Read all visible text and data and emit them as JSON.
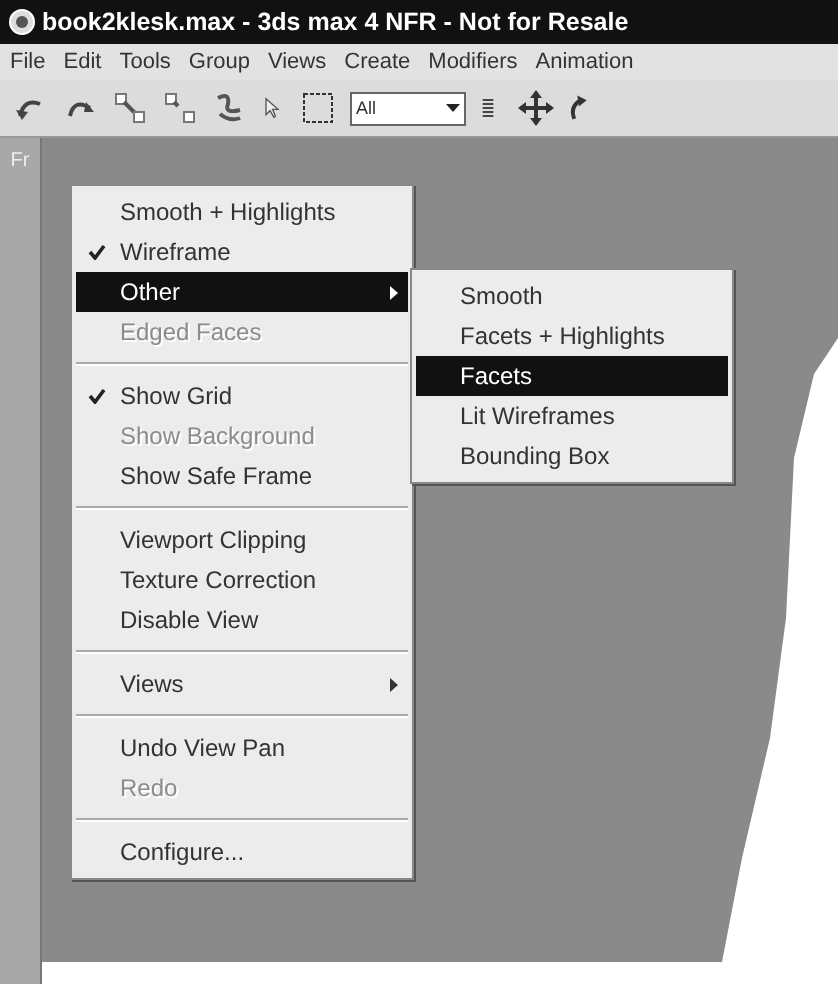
{
  "window": {
    "title": "book2klesk.max - 3ds max 4 NFR - Not for Resale"
  },
  "menu_bar": [
    "File",
    "Edit",
    "Tools",
    "Group",
    "Views",
    "Create",
    "Modifiers",
    "Animation"
  ],
  "toolbar": {
    "selection_filter": "All"
  },
  "viewport": {
    "label": "Fr"
  },
  "context_menu": [
    {
      "kind": "item",
      "label": "Smooth + Highlights",
      "checked": false,
      "disabled": false,
      "selected": false,
      "submenu": false
    },
    {
      "kind": "item",
      "label": "Wireframe",
      "checked": true,
      "disabled": false,
      "selected": false,
      "submenu": false
    },
    {
      "kind": "item",
      "label": "Other",
      "checked": false,
      "disabled": false,
      "selected": true,
      "submenu": true
    },
    {
      "kind": "item",
      "label": "Edged Faces",
      "checked": false,
      "disabled": true,
      "selected": false,
      "submenu": false
    },
    {
      "kind": "separator"
    },
    {
      "kind": "item",
      "label": "Show Grid",
      "checked": true,
      "disabled": false,
      "selected": false,
      "submenu": false
    },
    {
      "kind": "item",
      "label": "Show Background",
      "checked": false,
      "disabled": true,
      "selected": false,
      "submenu": false
    },
    {
      "kind": "item",
      "label": "Show Safe Frame",
      "checked": false,
      "disabled": false,
      "selected": false,
      "submenu": false
    },
    {
      "kind": "separator"
    },
    {
      "kind": "item",
      "label": "Viewport Clipping",
      "checked": false,
      "disabled": false,
      "selected": false,
      "submenu": false
    },
    {
      "kind": "item",
      "label": "Texture Correction",
      "checked": false,
      "disabled": false,
      "selected": false,
      "submenu": false
    },
    {
      "kind": "item",
      "label": "Disable View",
      "checked": false,
      "disabled": false,
      "selected": false,
      "submenu": false
    },
    {
      "kind": "separator"
    },
    {
      "kind": "item",
      "label": "Views",
      "checked": false,
      "disabled": false,
      "selected": false,
      "submenu": true
    },
    {
      "kind": "separator"
    },
    {
      "kind": "item",
      "label": "Undo View Pan",
      "checked": false,
      "disabled": false,
      "selected": false,
      "submenu": false
    },
    {
      "kind": "item",
      "label": "Redo",
      "checked": false,
      "disabled": true,
      "selected": false,
      "submenu": false
    },
    {
      "kind": "separator"
    },
    {
      "kind": "item",
      "label": "Configure...",
      "checked": false,
      "disabled": false,
      "selected": false,
      "submenu": false
    }
  ],
  "submenu": [
    {
      "label": "Smooth",
      "selected": false
    },
    {
      "label": "Facets + Highlights",
      "selected": false
    },
    {
      "label": "Facets",
      "selected": true
    },
    {
      "label": "Lit Wireframes",
      "selected": false
    },
    {
      "label": "Bounding Box",
      "selected": false
    }
  ]
}
